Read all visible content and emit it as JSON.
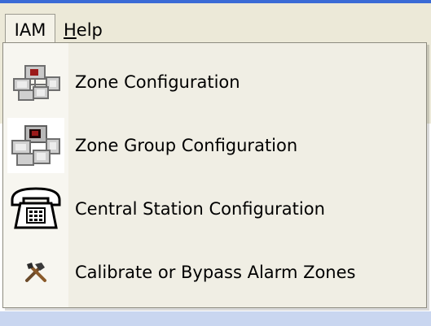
{
  "menubar": {
    "items": [
      {
        "label": "IAM"
      },
      {
        "label_first": "H",
        "label_rest": "elp"
      }
    ]
  },
  "dropdown": {
    "items": [
      {
        "label": "Zone Configuration",
        "icon": "zone-icon"
      },
      {
        "label": "Zone Group Configuration",
        "icon": "zone-group-icon"
      },
      {
        "label": "Central Station Configuration",
        "icon": "telephone-icon"
      },
      {
        "label": "Calibrate or Bypass Alarm Zones",
        "icon": "tools-icon"
      }
    ]
  },
  "colors": {
    "menu_bg": "#ece9d8",
    "dropdown_bg": "#f0eee4",
    "accent_blue": "#3a6bd6"
  }
}
